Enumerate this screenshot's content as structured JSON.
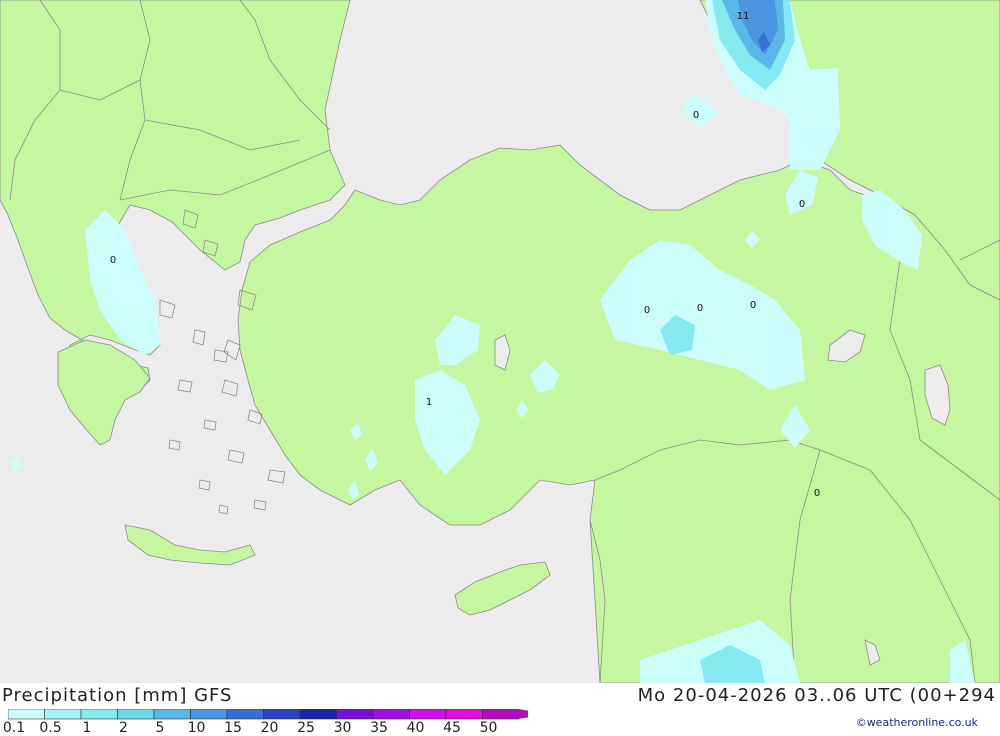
{
  "title": "Precipitation [mm] GFS",
  "datetime": "Mo 20-04-2026 03..06 UTC (00+294",
  "credit": "©weatheronline.co.uk",
  "legend": {
    "labels": [
      "0.1",
      "0.5",
      "1",
      "2",
      "5",
      "10",
      "15",
      "20",
      "25",
      "30",
      "35",
      "40",
      "45",
      "50"
    ],
    "colors": [
      "#ccffff",
      "#a8f5f5",
      "#84eaf0",
      "#6cd8ec",
      "#5ab8e6",
      "#4a95dd",
      "#3a6fd2",
      "#2a45bd",
      "#1a25a8",
      "#7a10d8",
      "#a010e0",
      "#cc10e6",
      "#e010d8",
      "#b010b8"
    ]
  },
  "map_values": [
    "11",
    "0",
    "0",
    "0",
    "0",
    "0",
    "0",
    "1",
    "0"
  ],
  "colors": {
    "sea": "#ececec",
    "land": "#c4f7a0",
    "border": "#8c8c8c"
  }
}
